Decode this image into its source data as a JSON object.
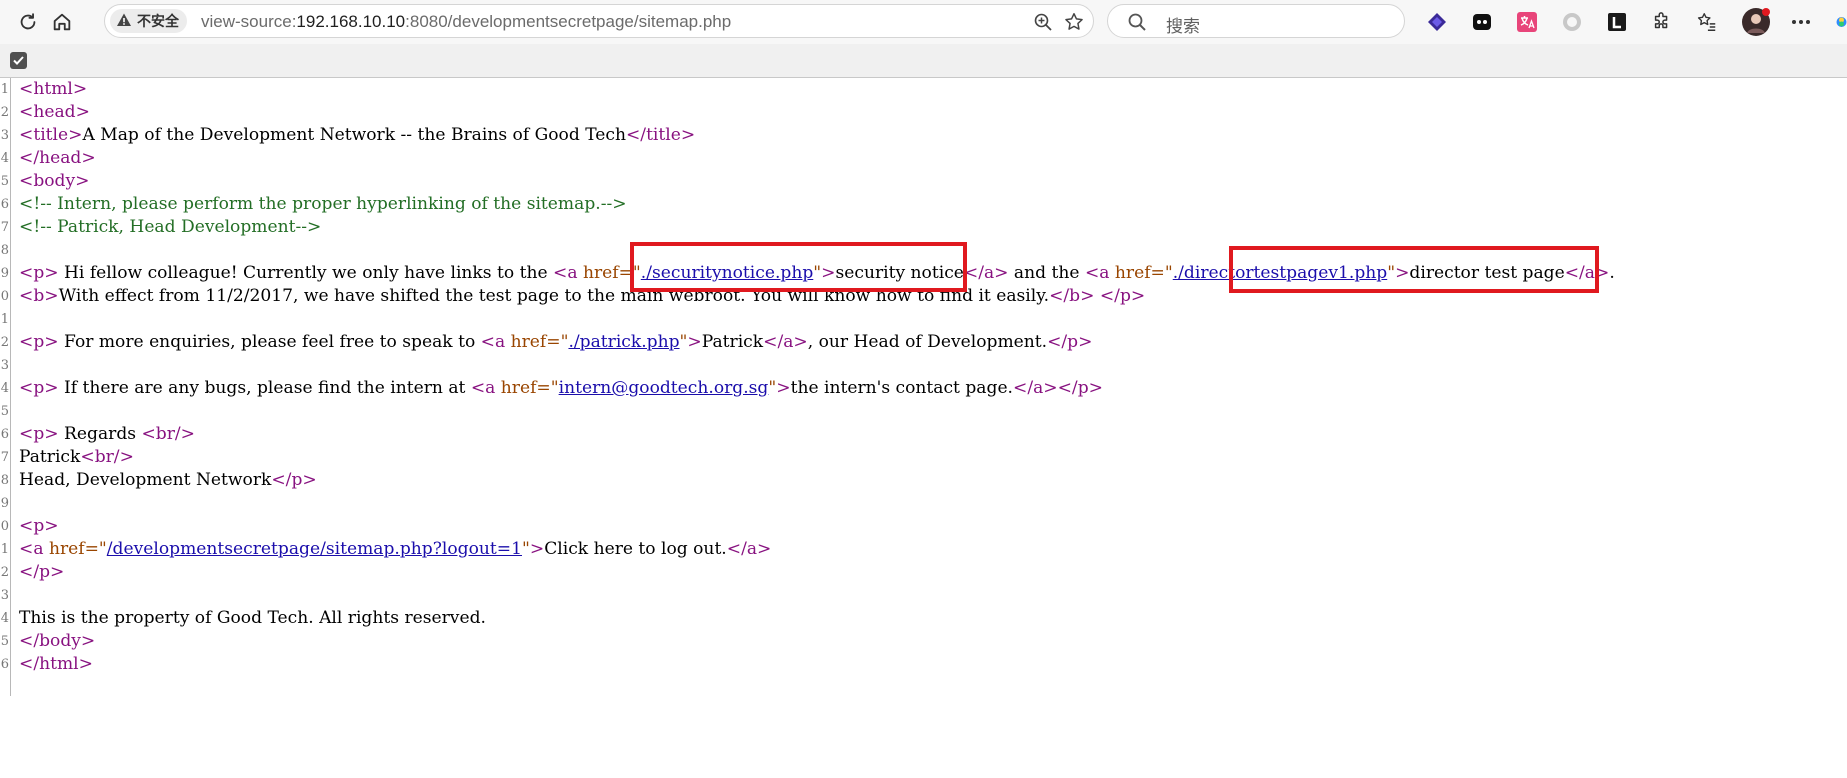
{
  "browser": {
    "security_label": "不安全",
    "url_prefix": "view-source:",
    "url_host": "192.168.10.10",
    "url_rest": ":8080/developmentsecretpage/sitemap.php",
    "search_placeholder": "搜索"
  },
  "source": {
    "line_numbers": [
      "1",
      "2",
      "3",
      "4",
      "5",
      "6",
      "7",
      "8",
      "9",
      "0",
      "1",
      "2",
      "3",
      "4",
      "5",
      "6",
      "7",
      "8",
      "9",
      "0",
      "1",
      "2",
      "3",
      "4",
      "5",
      "6"
    ],
    "l1_tag": "<html>",
    "l2_tag": "<head>",
    "l3_open": "<title>",
    "l3_text": "A Map of the Development Network -- the Brains of Good Tech",
    "l3_close": "</title>",
    "l4_tag": "</head>",
    "l5_tag": "<body>",
    "l6_comment": "<!-- Intern, please perform the proper hyperlinking of the sitemap.-->",
    "l7_comment": "<!-- Patrick, Head Development-->",
    "l9": {
      "p_open": "<p>",
      "text1": " Hi fellow colleague! Currently we only have links to the ",
      "a1_open": "<a ",
      "attr_href": "href=",
      "quote": "\"",
      "link1": "./securitynotice.php",
      "gt": ">",
      "text2": "security notice",
      "a_close": "</a>",
      "text3": " and the ",
      "link2": "./directortestpagev1.php",
      "text4": "director test page",
      "text5": "."
    },
    "l10": {
      "b_open": "<b>",
      "text": "With effect from 11/2/2017, we have shifted the test page to the main webroot. You will know how to find it easily.",
      "b_close": "</b>",
      "space": " ",
      "p_close": "</p>"
    },
    "l12": {
      "text1": " For more enquiries, please feel free to speak to ",
      "link": "./patrick.php",
      "text2": "Patrick",
      "text3": ", our Head of Development."
    },
    "l14": {
      "text1": " If there are any bugs, please find the intern at ",
      "link": "intern@goodtech.org.sg",
      "text2": "the intern's contact page."
    },
    "l16": {
      "text": " Regards ",
      "br": "<br/>"
    },
    "l17": {
      "text": "Patrick",
      "br": "<br/>"
    },
    "l18": {
      "text": "Head, Development Network"
    },
    "l20": {
      "p_open": "<p>"
    },
    "l21": {
      "link": "/developmentsecretpage/sitemap.php?logout=1",
      "text": "Click here to log out."
    },
    "l22": {
      "p_close": "</p>"
    },
    "l24": {
      "text": "This is the property of Good Tech. All rights reserved."
    },
    "l25_tag": "</body>",
    "l26_tag": "</html>"
  },
  "colors": {
    "tag": "#881280",
    "attribute": "#994500",
    "value": "#1a1aa6",
    "comment": "#236e25",
    "highlight_box": "#e0191f"
  }
}
